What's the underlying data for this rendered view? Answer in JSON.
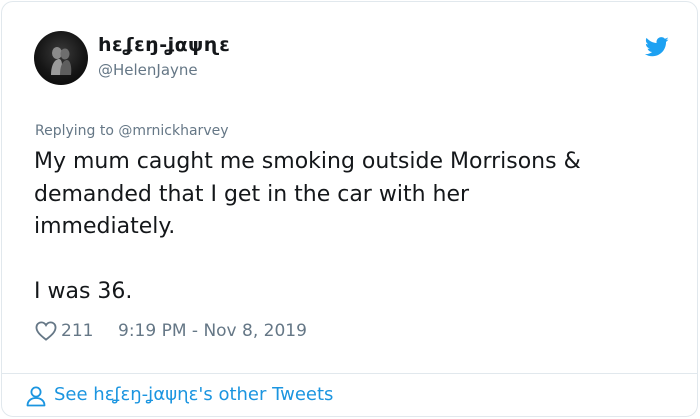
{
  "user": {
    "display_name": "hɛʆɛŋ-ʝαψɳɛ",
    "handle": "@HelenJayne"
  },
  "tweet": {
    "replying_prefix": "Replying to",
    "replying_handle": "@mrnickharvey",
    "text": "My mum caught me smoking outside Morrisons &\ndemanded that I get in the car with her\nimmediately.\n\nI was 36.",
    "likes": "211",
    "timestamp": "9:19 PM - Nov 8, 2019"
  },
  "footer": {
    "link_label": "See hɛʆɛŋ-ʝαψɳɛ's other Tweets"
  },
  "icons": {
    "brand": "twitter-bird-icon",
    "like": "heart-icon",
    "profile": "person-icon"
  },
  "colors": {
    "accent": "#1da1f2",
    "link": "#1b95e0",
    "muted": "#657786",
    "text": "#14171a",
    "border": "#e1e8ed"
  }
}
